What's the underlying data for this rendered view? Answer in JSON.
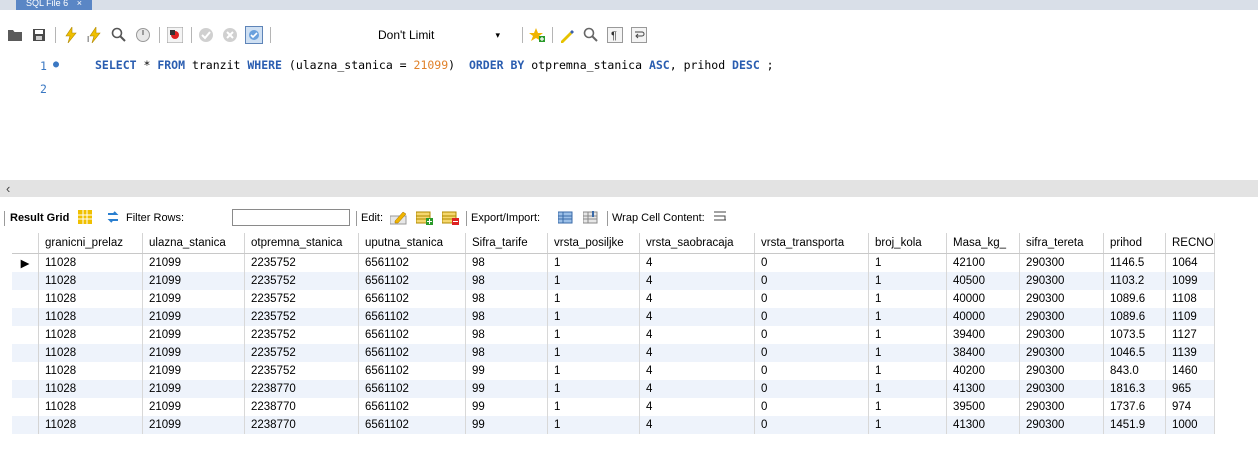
{
  "tab": {
    "title": "SQL File 6",
    "close": "×"
  },
  "toolbar": {
    "limit_value": "Don't Limit",
    "limit_arrow": "▾"
  },
  "editor": {
    "line1": "1",
    "line2": "2",
    "kw_select": "SELECT",
    "star": " * ",
    "kw_from": "FROM",
    "table": " tranzit ",
    "kw_where": "WHERE",
    "cond_open": " (ulazna_stanica = ",
    "cond_num": "21099",
    "cond_close": ")  ",
    "kw_order": "ORDER BY",
    "ord1": " otpremna_stanica ",
    "kw_asc": "ASC",
    "ord2": ", prihod ",
    "kw_desc": "DESC",
    "end": " ;"
  },
  "result_toolbar": {
    "result_grid": "Result Grid",
    "filter_rows": "Filter Rows:",
    "filter_value": "",
    "edit": "Edit:",
    "export_import": "Export/Import:",
    "wrap": "Wrap Cell Content:"
  },
  "grid": {
    "columns": [
      "granicni_prelaz",
      "ulazna_stanica",
      "otpremna_stanica",
      "uputna_stanica",
      "Sifra_tarife",
      "vrsta_posiljke",
      "vrsta_saobracaja",
      "vrsta_transporta",
      "broj_kola",
      "Masa_kg_",
      "sifra_tereta",
      "prihod",
      "RECNO"
    ],
    "rows": [
      [
        "11028",
        "21099",
        "2235752",
        "6561102",
        "98",
        "1",
        "4",
        "0",
        "1",
        "42100",
        "290300",
        "1146.5",
        "1064"
      ],
      [
        "11028",
        "21099",
        "2235752",
        "6561102",
        "98",
        "1",
        "4",
        "0",
        "1",
        "40500",
        "290300",
        "1103.2",
        "1099"
      ],
      [
        "11028",
        "21099",
        "2235752",
        "6561102",
        "98",
        "1",
        "4",
        "0",
        "1",
        "40000",
        "290300",
        "1089.6",
        "1108"
      ],
      [
        "11028",
        "21099",
        "2235752",
        "6561102",
        "98",
        "1",
        "4",
        "0",
        "1",
        "40000",
        "290300",
        "1089.6",
        "1109"
      ],
      [
        "11028",
        "21099",
        "2235752",
        "6561102",
        "98",
        "1",
        "4",
        "0",
        "1",
        "39400",
        "290300",
        "1073.5",
        "1127"
      ],
      [
        "11028",
        "21099",
        "2235752",
        "6561102",
        "98",
        "1",
        "4",
        "0",
        "1",
        "38400",
        "290300",
        "1046.5",
        "1139"
      ],
      [
        "11028",
        "21099",
        "2235752",
        "6561102",
        "99",
        "1",
        "4",
        "0",
        "1",
        "40200",
        "290300",
        "843.0",
        "1460"
      ],
      [
        "11028",
        "21099",
        "2238770",
        "6561102",
        "99",
        "1",
        "4",
        "0",
        "1",
        "41300",
        "290300",
        "1816.3",
        "965"
      ],
      [
        "11028",
        "21099",
        "2238770",
        "6561102",
        "99",
        "1",
        "4",
        "0",
        "1",
        "39500",
        "290300",
        "1737.6",
        "974"
      ],
      [
        "11028",
        "21099",
        "2238770",
        "6561102",
        "99",
        "1",
        "4",
        "0",
        "1",
        "41300",
        "290300",
        "1451.9",
        "1000"
      ]
    ],
    "current_row_marker": "▶"
  },
  "icons": [
    "folder-icon",
    "save-icon",
    "execute-icon",
    "execute-selection-icon",
    "explain-icon",
    "stop-icon",
    "toggle-error-icon",
    "commit-icon",
    "rollback-icon",
    "autocommit-icon",
    "star-add-icon",
    "beautify-icon",
    "find-icon",
    "invisible-chars-icon",
    "wrap-icon"
  ]
}
